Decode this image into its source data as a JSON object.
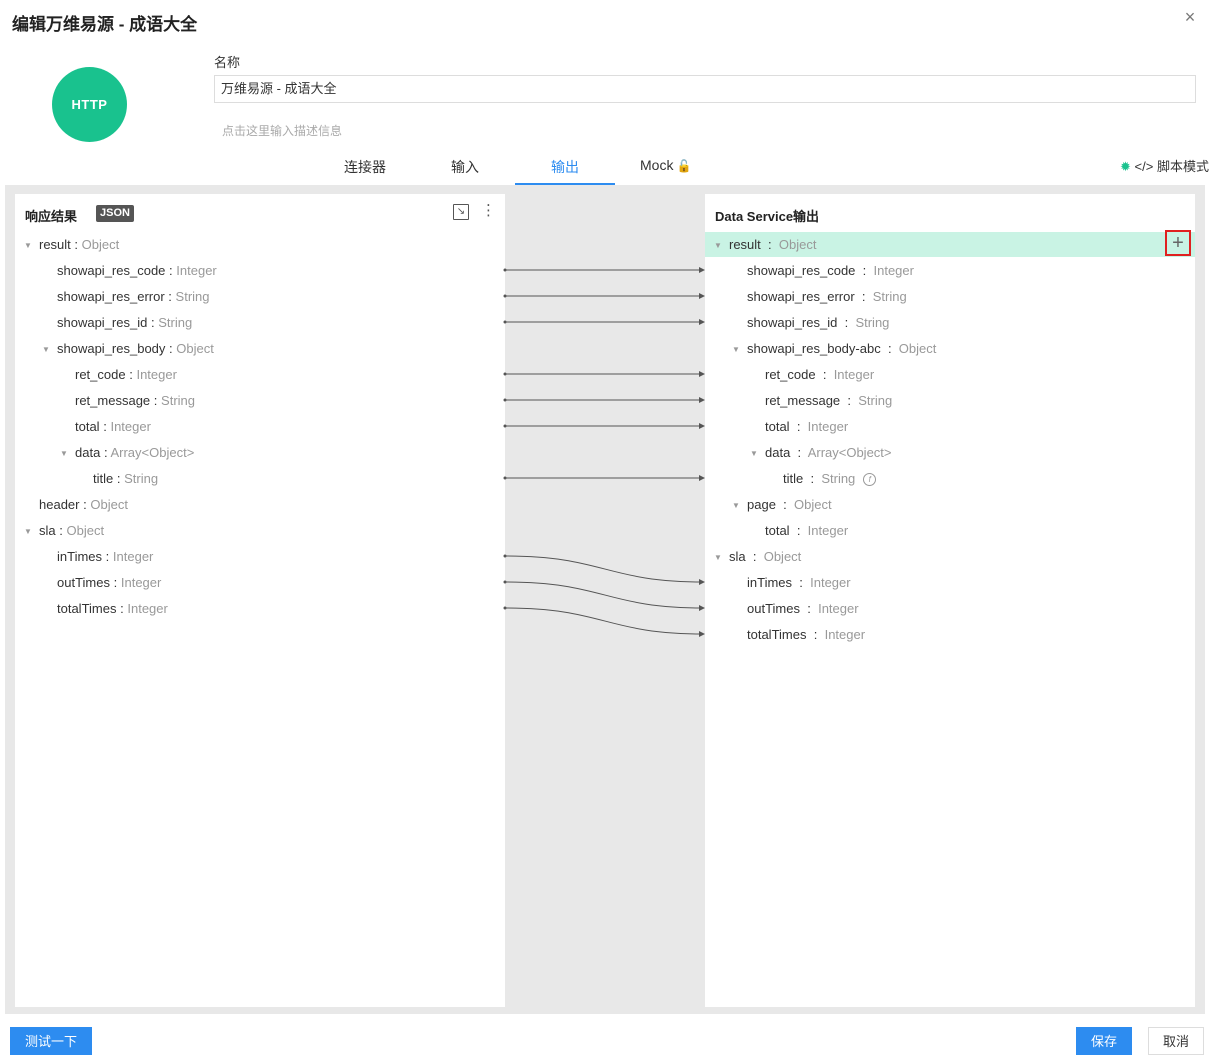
{
  "dialog": {
    "title": "编辑万维易源 - 成语大全",
    "close_icon": "×"
  },
  "connector": {
    "badge": "HTTP",
    "name_label": "名称",
    "name_value": "万维易源 - 成语大全",
    "desc_placeholder": "点击这里输入描述信息"
  },
  "tabs": [
    {
      "label": "连接器"
    },
    {
      "label": "输入"
    },
    {
      "label": "输出"
    },
    {
      "label": "Mock"
    }
  ],
  "script_mode": {
    "icon": "✹",
    "label": "</> 脚本模式"
  },
  "left": {
    "title": "响应结果",
    "badge": "JSON",
    "nodes": [
      {
        "name": "result",
        "type": "Object"
      },
      {
        "name": "showapi_res_code",
        "type": "Integer"
      },
      {
        "name": "showapi_res_error",
        "type": "String"
      },
      {
        "name": "showapi_res_id",
        "type": "String"
      },
      {
        "name": "showapi_res_body",
        "type": "Object"
      },
      {
        "name": "ret_code",
        "type": "Integer"
      },
      {
        "name": "ret_message",
        "type": "String"
      },
      {
        "name": "total",
        "type": "Integer"
      },
      {
        "name": "data",
        "type": "Array<Object>"
      },
      {
        "name": "title",
        "type": "String"
      },
      {
        "name": "header",
        "type": "Object"
      },
      {
        "name": "sla",
        "type": "Object"
      },
      {
        "name": "inTimes",
        "type": "Integer"
      },
      {
        "name": "outTimes",
        "type": "Integer"
      },
      {
        "name": "totalTimes",
        "type": "Integer"
      }
    ]
  },
  "right": {
    "title": "Data Service输出",
    "nodes": [
      {
        "name": "result",
        "type": "Object"
      },
      {
        "name": "showapi_res_code",
        "type": "Integer"
      },
      {
        "name": "showapi_res_error",
        "type": "String"
      },
      {
        "name": "showapi_res_id",
        "type": "String"
      },
      {
        "name": "showapi_res_body-abc",
        "type": "Object"
      },
      {
        "name": "ret_code",
        "type": "Integer"
      },
      {
        "name": "ret_message",
        "type": "String"
      },
      {
        "name": "total",
        "type": "Integer"
      },
      {
        "name": "data",
        "type": "Array<Object>"
      },
      {
        "name": "title",
        "type": "String"
      },
      {
        "name": "page",
        "type": "Object"
      },
      {
        "name": "total",
        "type": "Integer"
      },
      {
        "name": "sla",
        "type": "Object"
      },
      {
        "name": "inTimes",
        "type": "Integer"
      },
      {
        "name": "outTimes",
        "type": "Integer"
      },
      {
        "name": "totalTimes",
        "type": "Integer"
      }
    ]
  },
  "colon": ":",
  "footer": {
    "test_button": "测试一下",
    "save_button": "保存",
    "cancel_button": "取消"
  },
  "colors": {
    "accent": "#2d8cf0",
    "http_badge": "#19c28e",
    "highlight_row": "#c9f3e4",
    "focus_box": "#e02020"
  }
}
